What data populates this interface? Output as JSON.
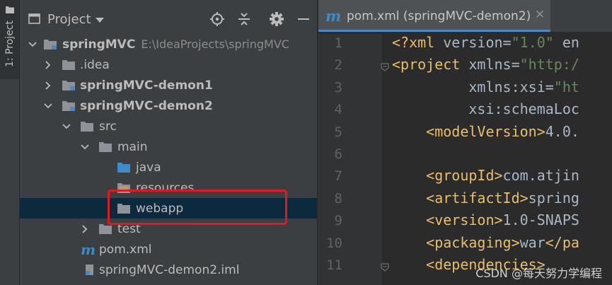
{
  "sidebar_stripe": {
    "label": "1: Project"
  },
  "panel": {
    "title": "Project",
    "buttons": [
      "locate-icon",
      "collapse-icon",
      "gear-icon",
      "minimize-icon"
    ]
  },
  "tree": [
    {
      "label": "springMVC",
      "path": "E:\\IdeaProjects\\springMVC",
      "bold": true,
      "expanded": true,
      "icon": "module-folder-icon"
    },
    {
      "label": ".idea",
      "expanded": false,
      "icon": "folder-icon"
    },
    {
      "label": "springMVC-demon1",
      "bold": true,
      "expanded": false,
      "icon": "module-folder-icon"
    },
    {
      "label": "springMVC-demon2",
      "bold": true,
      "expanded": true,
      "icon": "module-folder-icon"
    },
    {
      "label": "src",
      "expanded": true,
      "icon": "folder-icon"
    },
    {
      "label": "main",
      "expanded": true,
      "icon": "folder-icon"
    },
    {
      "label": "java",
      "icon": "source-folder-icon"
    },
    {
      "label": "resources",
      "icon": "resources-folder-icon"
    },
    {
      "label": "webapp",
      "icon": "folder-icon",
      "selected": true
    },
    {
      "label": "test",
      "expanded": false,
      "icon": "folder-icon"
    },
    {
      "label": "pom.xml",
      "icon": "maven-icon"
    },
    {
      "label": "springMVC-demon2.iml",
      "icon": "iml-file-icon"
    }
  ],
  "editor": {
    "tab": {
      "icon": "m",
      "title": "pom.xml (springMVC-demon2)",
      "close": "✕"
    },
    "lines": [
      {
        "n": "1",
        "code": "<?xml version=\"1.0\" en"
      },
      {
        "n": "2",
        "code": "<project xmlns=\"http:/"
      },
      {
        "n": "3",
        "code": "         xmlns:xsi=\"ht"
      },
      {
        "n": "4",
        "code": "         xsi:schemaLoc"
      },
      {
        "n": "5",
        "code": "    <modelVersion>4.0."
      },
      {
        "n": "6",
        "code": ""
      },
      {
        "n": "7",
        "code": "    <groupId>com.atjin"
      },
      {
        "n": "8",
        "code": "    <artifactId>spring"
      },
      {
        "n": "9",
        "code": "    <version>1.0-SNAPS"
      },
      {
        "n": "10",
        "code": "    <packaging>war</pa"
      },
      {
        "n": "11",
        "code": "    <dependencies>"
      }
    ]
  },
  "watermark": "CSDN @每天努力学编程",
  "colors": {
    "selection": "#0d293e",
    "highlight_box": "#e0181f",
    "tab_underline": "#4a88c7",
    "maven_blue": "#3d8cc9"
  }
}
